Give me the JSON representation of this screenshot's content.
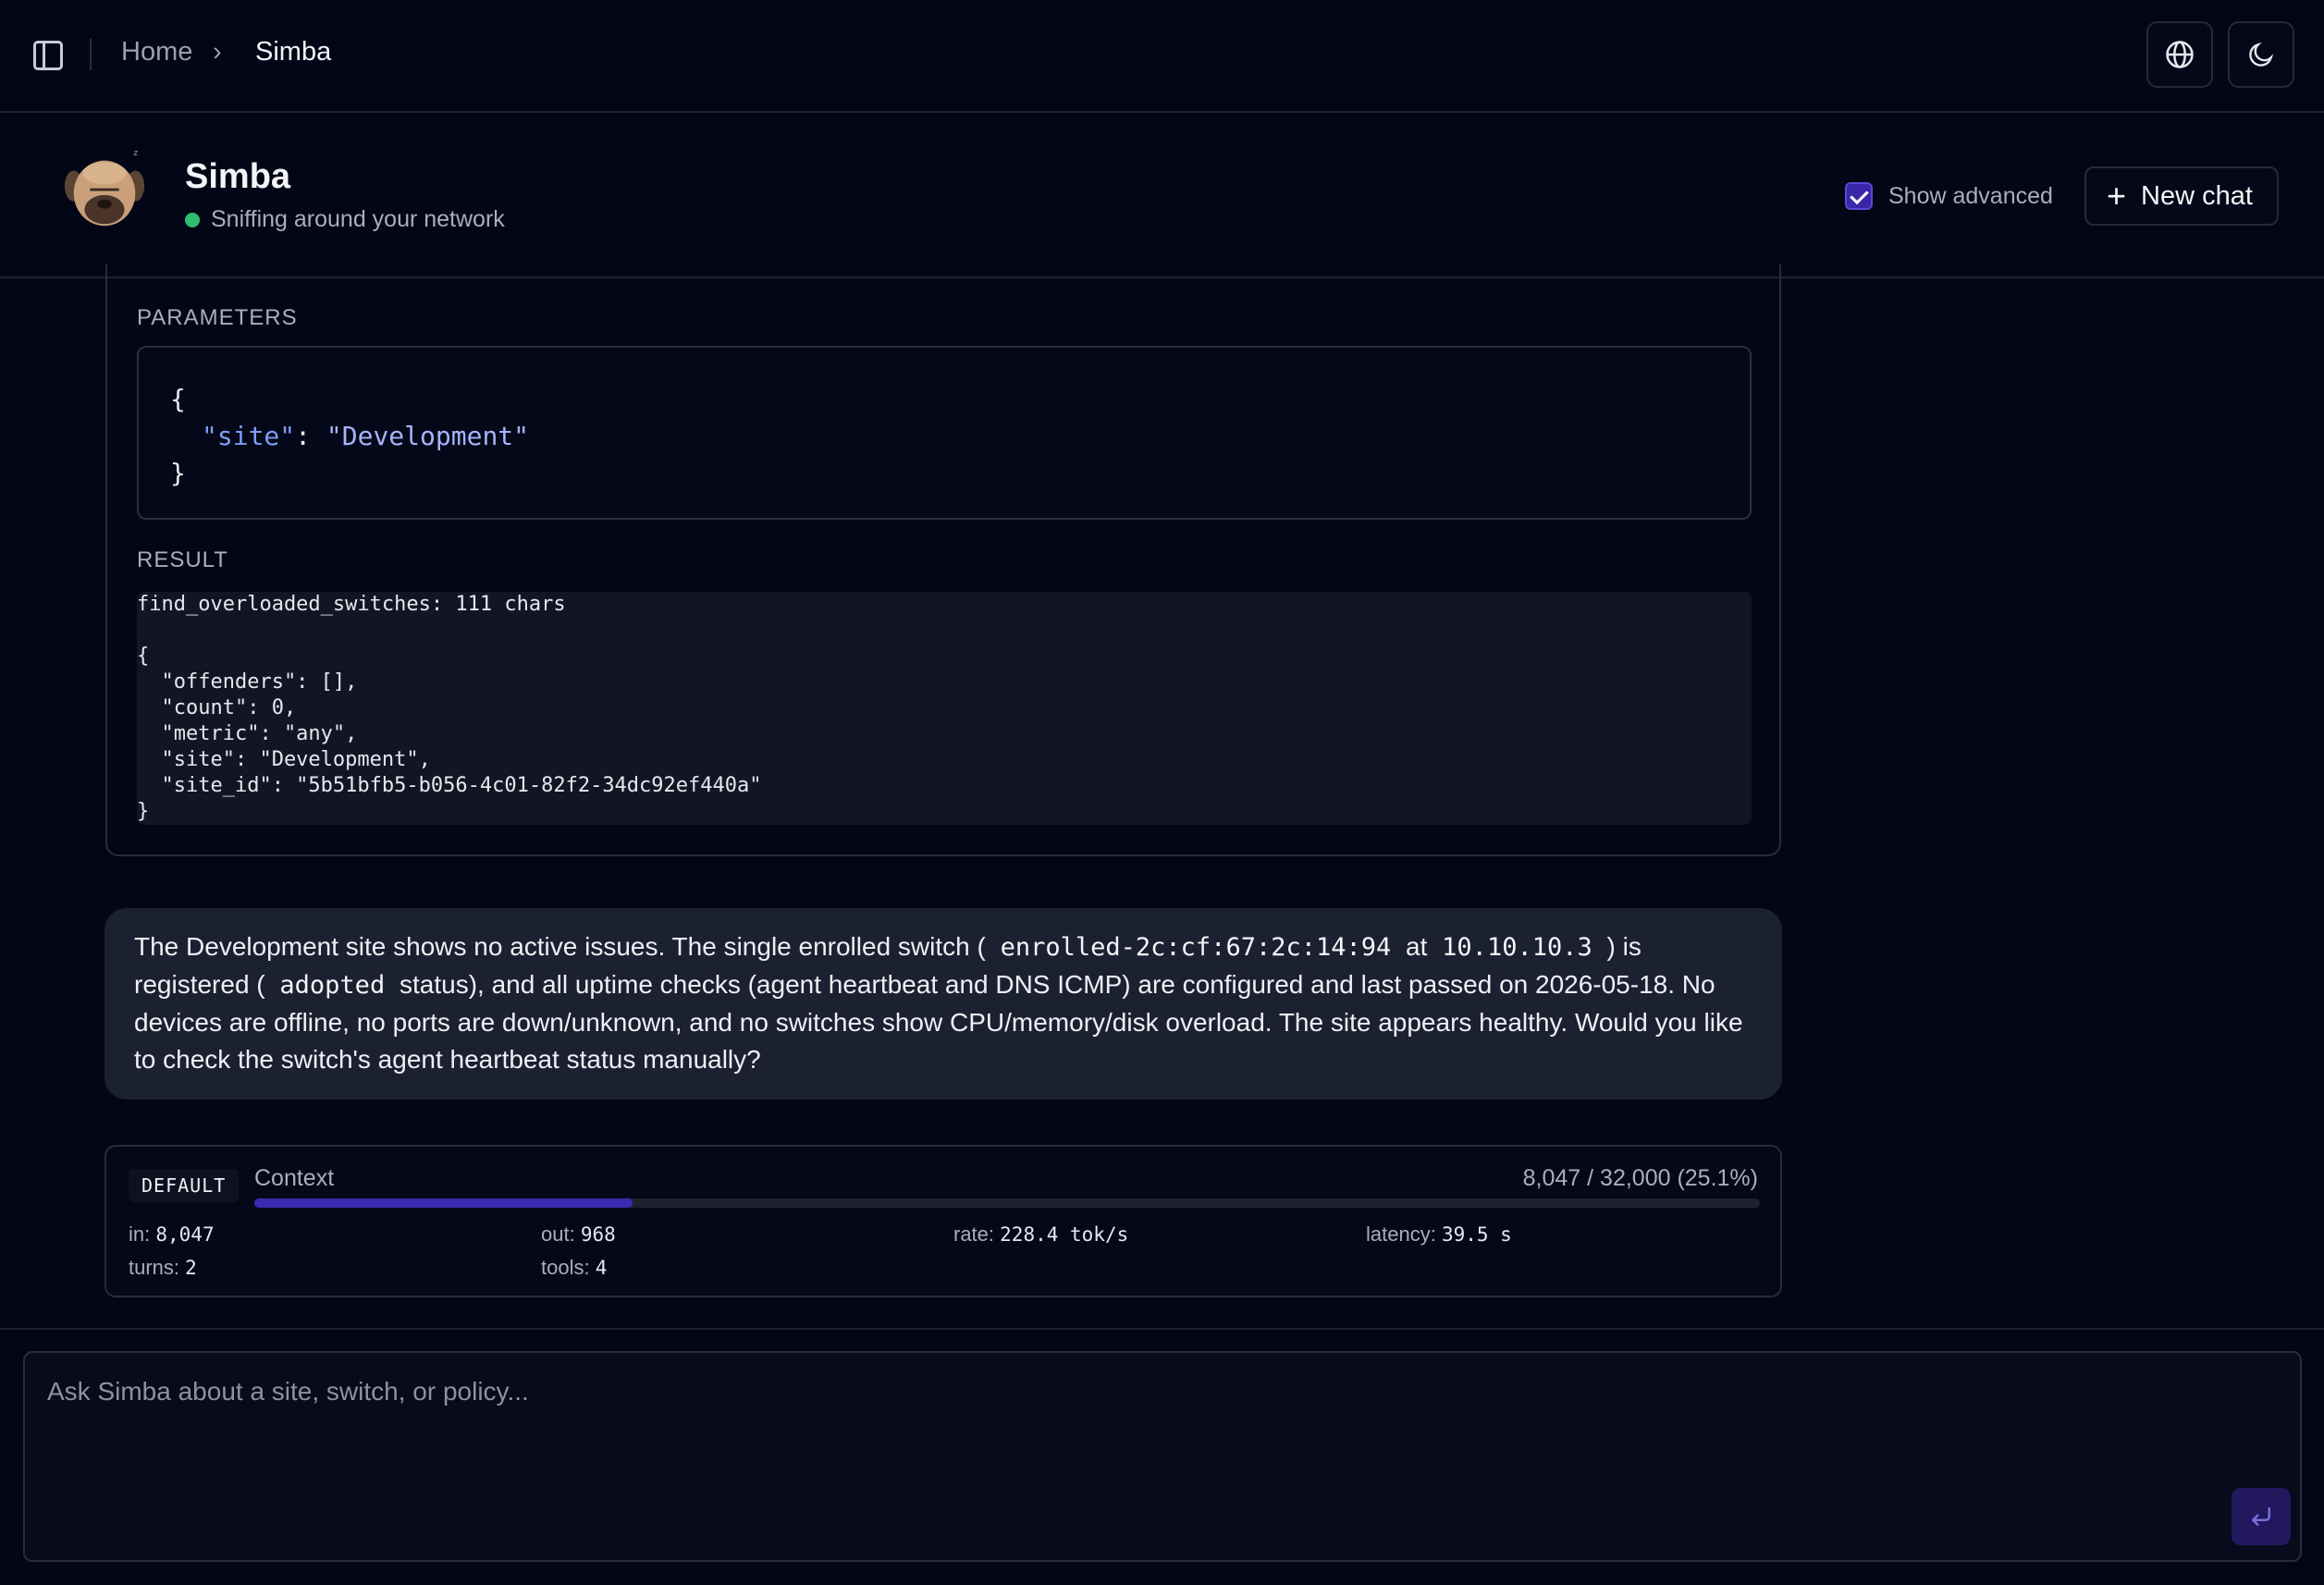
{
  "breadcrumb": {
    "home": "Home",
    "separator": "›",
    "current": "Simba"
  },
  "topbar": {
    "globe_icon": "globe-icon",
    "theme_icon": "moon-icon",
    "sidebar_icon": "sidebar-toggle-icon"
  },
  "agent": {
    "name": "Simba",
    "status": "Sniffing around your network",
    "status_color": "#2fbf71"
  },
  "header": {
    "show_advanced_label": "Show advanced",
    "show_advanced_checked": true,
    "new_chat_label": "New chat"
  },
  "tool_call": {
    "parameters_label": "PARAMETERS",
    "params": {
      "open": "{",
      "key": "\"site\"",
      "colon": ": ",
      "value": "\"Development\"",
      "close": "}"
    },
    "result_label": "RESULT",
    "result_text": "find_overloaded_switches: 111 chars\n\n{\n  \"offenders\": [],\n  \"count\": 0,\n  \"metric\": \"any\",\n  \"site\": \"Development\",\n  \"site_id\": \"5b51bfb5-b056-4c01-82f2-34dc92ef440a\"\n}"
  },
  "message": {
    "p1": "The Development site shows no active issues. The single enrolled switch (",
    "code1": "enrolled-2c:cf:67:2c:14:94",
    "p2": "at",
    "code2": "10.10.10.3",
    "p3": ") is registered (",
    "code3": "adopted",
    "p4": "status), and all uptime checks (agent heartbeat and DNS ICMP) are configured and last passed on 2026-05-18. No devices are offline, no ports are down/unknown, and no switches show CPU/memory/disk overload. The site appears healthy. Would you like to check the switch's agent heartbeat status manually?"
  },
  "stats": {
    "model_badge": "DEFAULT",
    "context_label": "Context",
    "context_value": "8,047 / 32,000 (25.1%)",
    "context_fraction": 0.251,
    "in_label": "in:",
    "in_value": "8,047",
    "out_label": "out:",
    "out_value": "968",
    "rate_label": "rate:",
    "rate_value": "228.4 tok/s",
    "latency_label": "latency:",
    "latency_value": "39.5 s",
    "turns_label": "turns:",
    "turns_value": "2",
    "tools_label": "tools:",
    "tools_value": "4"
  },
  "composer": {
    "placeholder": "Ask Simba about a site, switch, or policy...",
    "value": "",
    "send_icon": "enter-icon"
  },
  "colors": {
    "accent": "#3b2bb0",
    "background": "#030616",
    "bubble": "#1c2131"
  }
}
